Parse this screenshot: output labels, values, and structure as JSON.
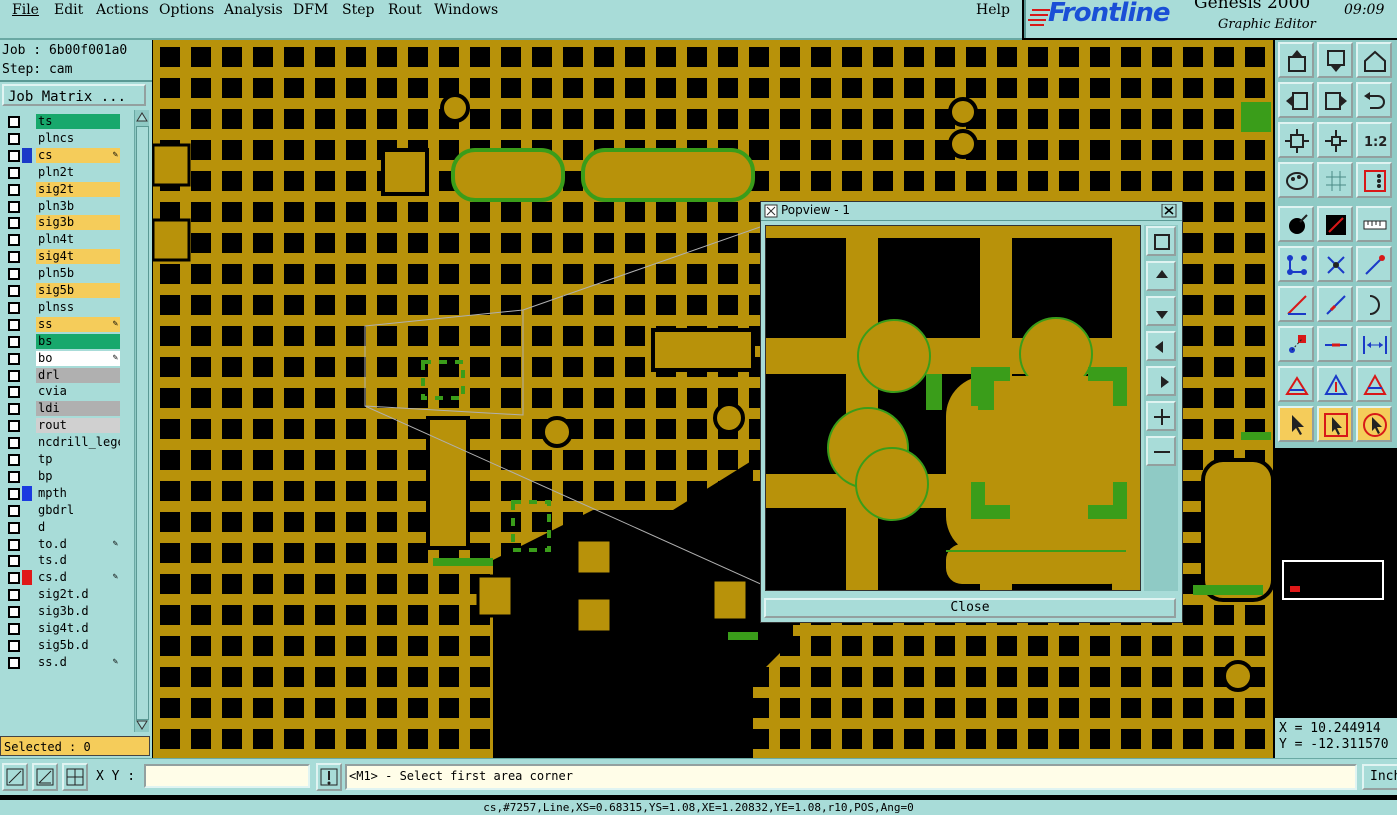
{
  "menubar": {
    "items": [
      "File",
      "Edit",
      "Actions",
      "Options",
      "Analysis",
      "DFM",
      "Step",
      "Rout",
      "Windows"
    ],
    "help": "Help"
  },
  "brand": {
    "logo": "Frontline",
    "product": "Genesis 2000",
    "subtitle": "Graphic Editor",
    "clock": "09:09"
  },
  "job": {
    "job_line": "Job : 6b00f001a0",
    "step_line": "Step: cam",
    "matrix_button": "Job Matrix ..."
  },
  "layers": [
    {
      "name": "ts",
      "color": "#18a86c",
      "icon": ""
    },
    {
      "name": "plncs",
      "color": "#a8dcd8",
      "icon": ""
    },
    {
      "name": "cs",
      "color": "#f5cc5a",
      "icon": "pencil-grid",
      "swatch": "#1a3ac8"
    },
    {
      "name": "pln2t",
      "color": "#a8dcd8",
      "icon": ""
    },
    {
      "name": "sig2t",
      "color": "#f5cc5a",
      "icon": ""
    },
    {
      "name": "pln3b",
      "color": "#a8dcd8",
      "icon": ""
    },
    {
      "name": "sig3b",
      "color": "#f5cc5a",
      "icon": ""
    },
    {
      "name": "pln4t",
      "color": "#a8dcd8",
      "icon": ""
    },
    {
      "name": "sig4t",
      "color": "#f5cc5a",
      "icon": ""
    },
    {
      "name": "pln5b",
      "color": "#a8dcd8",
      "icon": ""
    },
    {
      "name": "sig5b",
      "color": "#f5cc5a",
      "icon": ""
    },
    {
      "name": "plnss",
      "color": "#a8dcd8",
      "icon": ""
    },
    {
      "name": "ss",
      "color": "#f5cc5a",
      "icon": "pencil"
    },
    {
      "name": "bs",
      "color": "#18a86c",
      "icon": ""
    },
    {
      "name": "bo",
      "color": "#ffffff",
      "icon": "pencil"
    },
    {
      "name": "drl",
      "color": "#b0b0b0",
      "icon": ""
    },
    {
      "name": "cvia",
      "color": "#a8dcd8",
      "icon": ""
    },
    {
      "name": "ldi",
      "color": "#b0b0b0",
      "icon": ""
    },
    {
      "name": "rout",
      "color": "#d0d0d0",
      "icon": ""
    },
    {
      "name": "ncdrill_lege",
      "color": "#a8dcd8",
      "icon": ""
    },
    {
      "name": "tp",
      "color": "#a8dcd8",
      "icon": ""
    },
    {
      "name": "bp",
      "color": "#a8dcd8",
      "icon": ""
    },
    {
      "name": "mpth",
      "color": "#a8dcd8",
      "icon": "",
      "swatch": "#1a3ae0"
    },
    {
      "name": "gbdrl",
      "color": "#a8dcd8",
      "icon": ""
    },
    {
      "name": "d",
      "color": "#a8dcd8",
      "icon": ""
    },
    {
      "name": "to.d",
      "color": "#a8dcd8",
      "icon": "pencil"
    },
    {
      "name": "ts.d",
      "color": "#a8dcd8",
      "icon": ""
    },
    {
      "name": "cs.d",
      "color": "#a8dcd8",
      "icon": "pencil",
      "swatch": "#e01818"
    },
    {
      "name": "sig2t.d",
      "color": "#a8dcd8",
      "icon": ""
    },
    {
      "name": "sig3b.d",
      "color": "#a8dcd8",
      "icon": ""
    },
    {
      "name": "sig4t.d",
      "color": "#a8dcd8",
      "icon": ""
    },
    {
      "name": "sig5b.d",
      "color": "#a8dcd8",
      "icon": ""
    },
    {
      "name": "ss.d",
      "color": "#a8dcd8",
      "icon": "pencil"
    }
  ],
  "selected": "Selected : 0",
  "popview": {
    "title": "Popview - 1",
    "close": "Close"
  },
  "coords": {
    "x": "X = 10.244914",
    "y": "Y = -12.311570"
  },
  "bottombar": {
    "xy_label": "X Y :",
    "xy_value": "",
    "prompt": "<M1> - Select first area corner",
    "units_button": "Inch"
  },
  "status_line": "cs,#7257,Line,XS=0.68315,YS=1.08,XE=1.20832,YE=1.08,r10,POS,Ang=0",
  "colors": {
    "panel": "#a8dcd8",
    "copper": "#b8920a",
    "mask": "#3a9d1a",
    "background": "#000000",
    "highlight": "#f5cc5a"
  }
}
